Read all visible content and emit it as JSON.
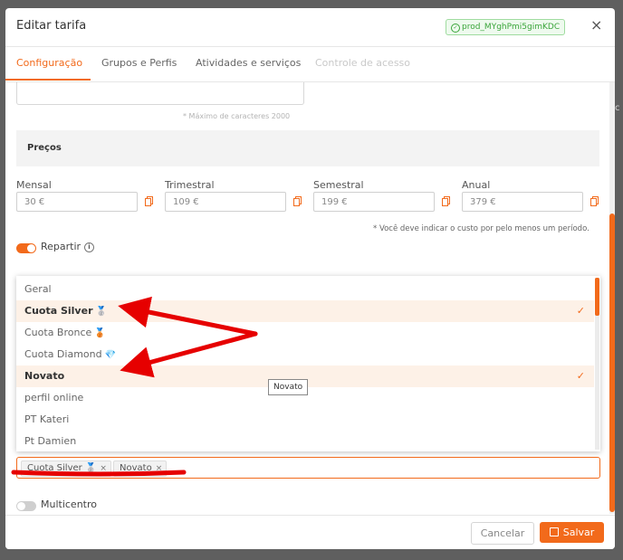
{
  "header": {
    "title": "Editar tarifa",
    "product_id": "prod_MYghPmi5gimKDC",
    "close_symbol": "×"
  },
  "tabs": [
    {
      "label": "Configuração",
      "state": "active"
    },
    {
      "label": "Grupos e Perfis",
      "state": "normal"
    },
    {
      "label": "Atividades e serviços",
      "state": "normal"
    },
    {
      "label": "Controle de acesso",
      "state": "disabled"
    }
  ],
  "description": {
    "max_chars_note": "* Máximo de caracteres 2000"
  },
  "prices": {
    "section_title": "Preços",
    "periods": [
      {
        "label": "Mensal",
        "value": "30 €"
      },
      {
        "label": "Trimestral",
        "value": "109 €"
      },
      {
        "label": "Semestral",
        "value": "199 €"
      },
      {
        "label": "Anual",
        "value": "379 €"
      }
    ],
    "note": "* Você deve indicar o custo por pelo menos um período."
  },
  "repartir": {
    "label": "Repartir",
    "enabled": true
  },
  "dropdown": {
    "options": [
      {
        "label": "Geral",
        "emoji": "",
        "selected": false
      },
      {
        "label": "Cuota Silver",
        "emoji": "🥈",
        "selected": true
      },
      {
        "label": "Cuota Bronce",
        "emoji": "🥉",
        "selected": false
      },
      {
        "label": "Cuota Diamond",
        "emoji": "💎",
        "selected": false
      },
      {
        "label": "Novato",
        "emoji": "",
        "selected": true
      },
      {
        "label": "perfil online",
        "emoji": "",
        "selected": false
      },
      {
        "label": "PT Kateri",
        "emoji": "",
        "selected": false
      },
      {
        "label": "Pt Damien",
        "emoji": "",
        "selected": false
      }
    ],
    "check_symbol": "✓",
    "tooltip": "Novato"
  },
  "selected_tags": [
    {
      "label": "Cuota Silver",
      "emoji": "🥈"
    },
    {
      "label": "Novato",
      "emoji": ""
    }
  ],
  "multicentro": {
    "label": "Multicentro",
    "enabled": false
  },
  "footer": {
    "cancel_label": "Cancelar",
    "save_label": "Salvar"
  },
  "colors": {
    "accent": "#f26a1b",
    "annotation": "#e60000",
    "badge_green": "#3aa53a"
  }
}
